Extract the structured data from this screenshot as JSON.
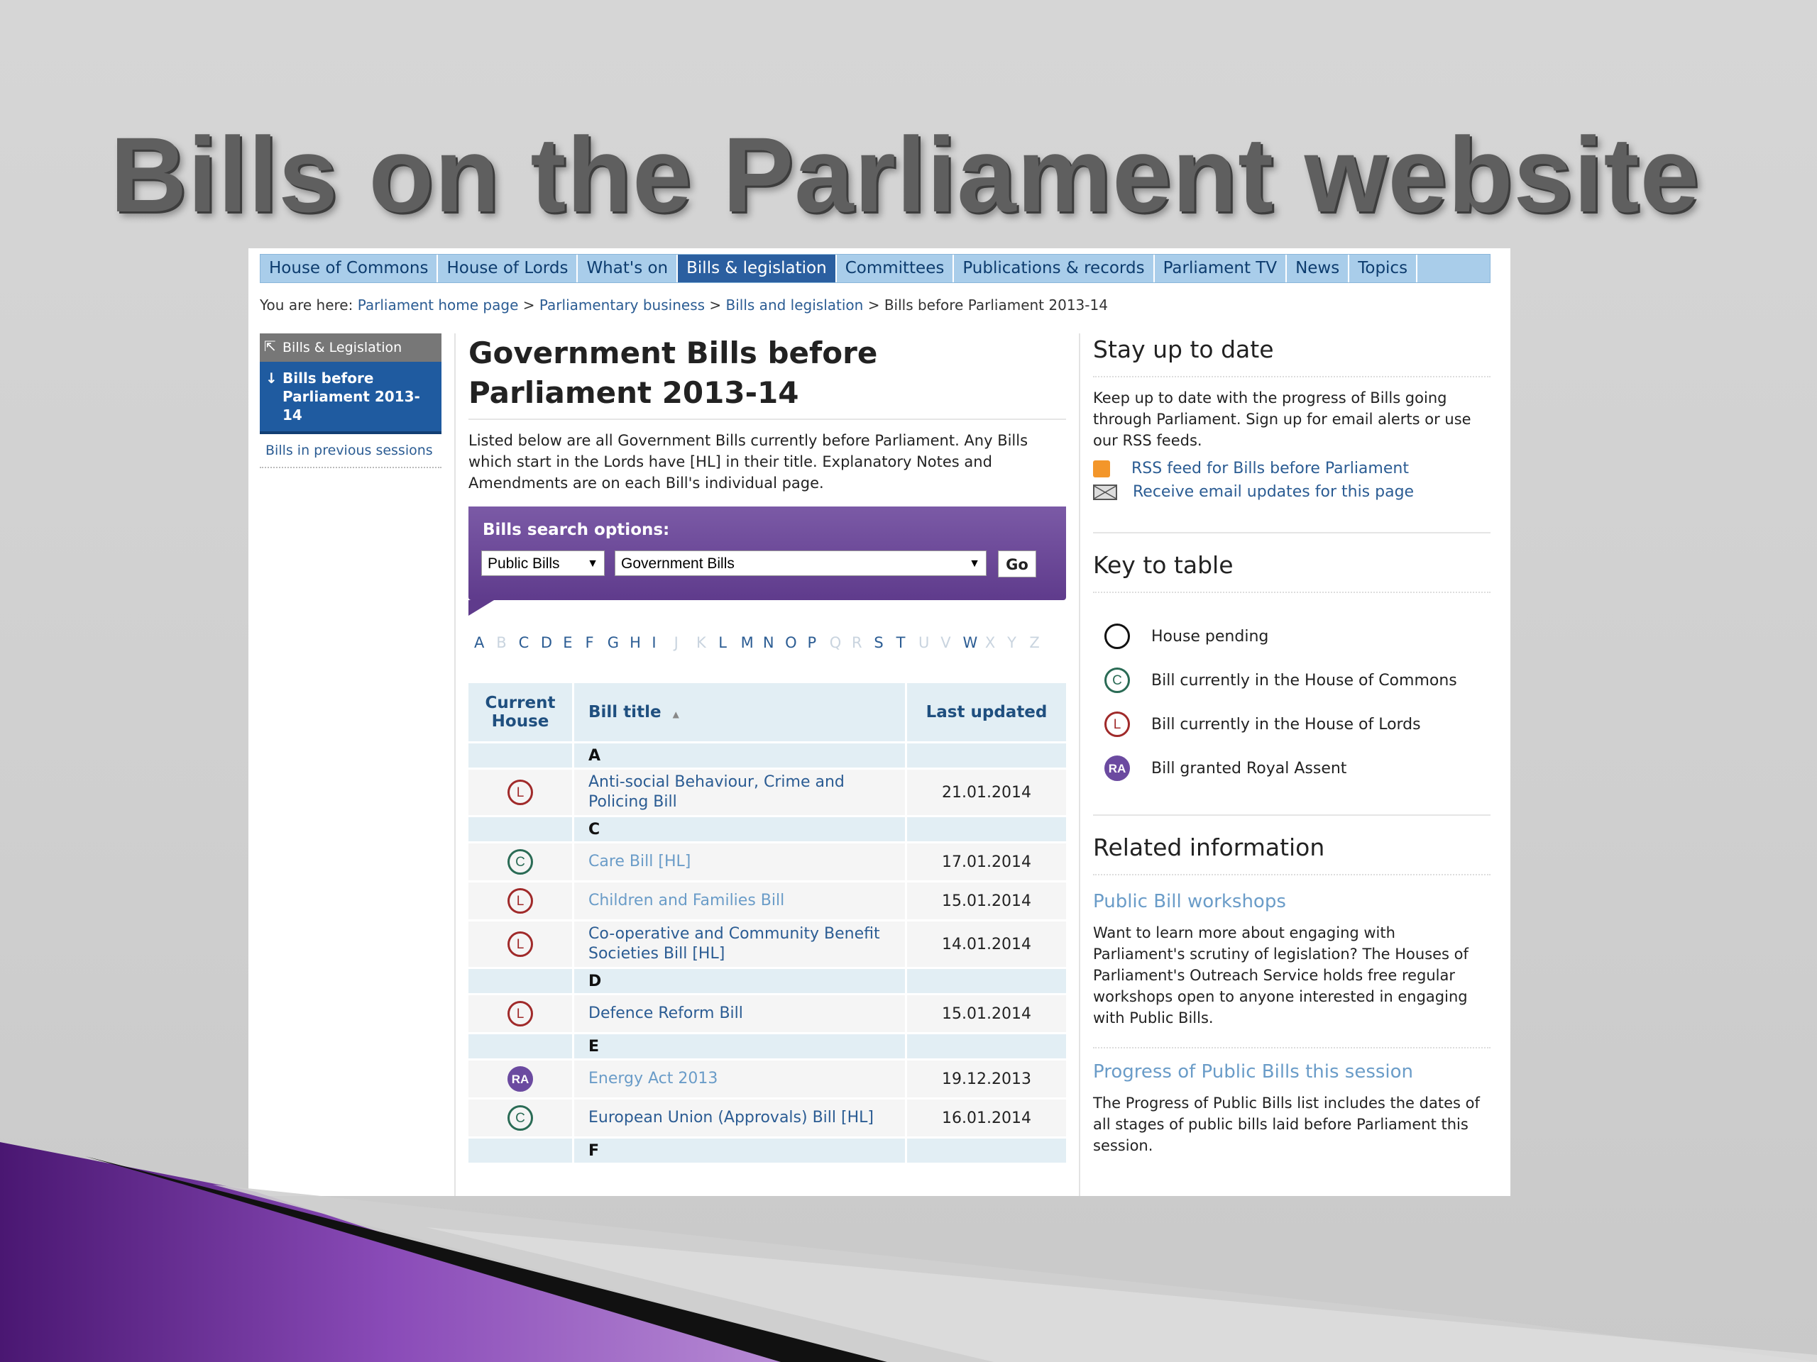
{
  "slide": {
    "title": "Bills on the Parliament website"
  },
  "nav": {
    "tabs": [
      "House of Commons",
      "House of Lords",
      "What's on",
      "Bills & legislation",
      "Committees",
      "Publications & records",
      "Parliament TV",
      "News",
      "Topics"
    ],
    "active": "Bills & legislation"
  },
  "breadcrumb": {
    "prefix": "You are here:",
    "links": [
      "Parliament home page",
      "Parliamentary business",
      "Bills and legislation"
    ],
    "separator": ">",
    "current": "Bills before Parliament 2013-14"
  },
  "sidebar": {
    "up_label": "Bills & Legislation",
    "current_label": "Bills before Parliament 2013-14",
    "prev_label": "Bills in previous sessions"
  },
  "main": {
    "title": "Government Bills before Parliament 2013-14",
    "intro": "Listed below are all Government Bills currently before Parliament. Any Bills which start in the Lords have [HL] in their title. Explanatory Notes and Amendments are on each Bill's individual page.",
    "search": {
      "label": "Bills search options:",
      "type_select": "Public Bills",
      "category_select": "Government Bills",
      "go": "Go"
    },
    "alphabet": [
      {
        "l": "A",
        "on": true
      },
      {
        "l": "B",
        "on": false
      },
      {
        "l": "C",
        "on": true
      },
      {
        "l": "D",
        "on": true
      },
      {
        "l": "E",
        "on": true
      },
      {
        "l": "F",
        "on": true
      },
      {
        "l": "G",
        "on": true
      },
      {
        "l": "H",
        "on": true
      },
      {
        "l": "I",
        "on": true
      },
      {
        "l": "J",
        "on": false
      },
      {
        "l": "K",
        "on": false
      },
      {
        "l": "L",
        "on": true
      },
      {
        "l": "M",
        "on": true
      },
      {
        "l": "N",
        "on": true
      },
      {
        "l": "O",
        "on": true
      },
      {
        "l": "P",
        "on": true
      },
      {
        "l": "Q",
        "on": false
      },
      {
        "l": "R",
        "on": false
      },
      {
        "l": "S",
        "on": true
      },
      {
        "l": "T",
        "on": true
      },
      {
        "l": "U",
        "on": false
      },
      {
        "l": "V",
        "on": false
      },
      {
        "l": "W",
        "on": true
      },
      {
        "l": "X",
        "on": false
      },
      {
        "l": "Y",
        "on": false
      },
      {
        "l": "Z",
        "on": false
      }
    ],
    "table": {
      "headers": {
        "house": "Current House",
        "title": "Bill title",
        "sort_icon": "▲",
        "updated": "Last updated"
      },
      "groups": [
        {
          "letter": "A",
          "rows": [
            {
              "house": "L",
              "title": "Anti-social Behaviour, Crime and Policing Bill",
              "updated": "21.01.2014",
              "visited": false
            }
          ]
        },
        {
          "letter": "C",
          "rows": [
            {
              "house": "C",
              "title": "Care Bill [HL]",
              "updated": "17.01.2014",
              "visited": true
            },
            {
              "house": "L",
              "title": "Children and Families Bill",
              "updated": "15.01.2014",
              "visited": true
            },
            {
              "house": "L",
              "title": "Co-operative and Community Benefit Societies Bill [HL]",
              "updated": "14.01.2014",
              "visited": false
            }
          ]
        },
        {
          "letter": "D",
          "rows": [
            {
              "house": "L",
              "title": "Defence Reform Bill",
              "updated": "15.01.2014",
              "visited": false
            }
          ]
        },
        {
          "letter": "E",
          "rows": [
            {
              "house": "RA",
              "title": "Energy Act 2013",
              "updated": "19.12.2013",
              "visited": true
            },
            {
              "house": "C",
              "title": "European Union (Approvals) Bill [HL]",
              "updated": "16.01.2014",
              "visited": false
            }
          ]
        },
        {
          "letter": "F",
          "rows": []
        }
      ]
    }
  },
  "right": {
    "stay": {
      "heading": "Stay up to date",
      "text": "Keep up to date with the progress of Bills going through Parliament. Sign up for email alerts or use our RSS feeds.",
      "rss_link": "RSS feed for Bills before Parliament",
      "email_link": "Receive email updates for this page"
    },
    "key": {
      "heading": "Key to table",
      "items": [
        {
          "badge": "",
          "kind": "pend",
          "label": "House pending"
        },
        {
          "badge": "C",
          "kind": "c",
          "label": "Bill currently in the House of Commons"
        },
        {
          "badge": "L",
          "kind": "l",
          "label": "Bill currently in the House of Lords"
        },
        {
          "badge": "RA",
          "kind": "ra",
          "label": "Bill granted Royal Assent"
        }
      ]
    },
    "related": {
      "heading": "Related information",
      "workshops_link": "Public Bill workshops",
      "workshops_text": "Want to learn more about engaging with Parliament's scrutiny of legislation? The Houses of Parliament's Outreach Service holds free regular workshops open to anyone interested in engaging with Public Bills.",
      "progress_link": "Progress of Public Bills this session",
      "progress_text": "The Progress of Public Bills list includes the dates of all stages of public bills laid before Parliament this session."
    }
  },
  "colors": {
    "nav_bg": "#a9cdea",
    "nav_active": "#2b5fa0",
    "search_purple": "#6b4aa0",
    "lords_red": "#a02a2a",
    "commons_green": "#2a6b55",
    "link_blue": "#2b5c93"
  }
}
